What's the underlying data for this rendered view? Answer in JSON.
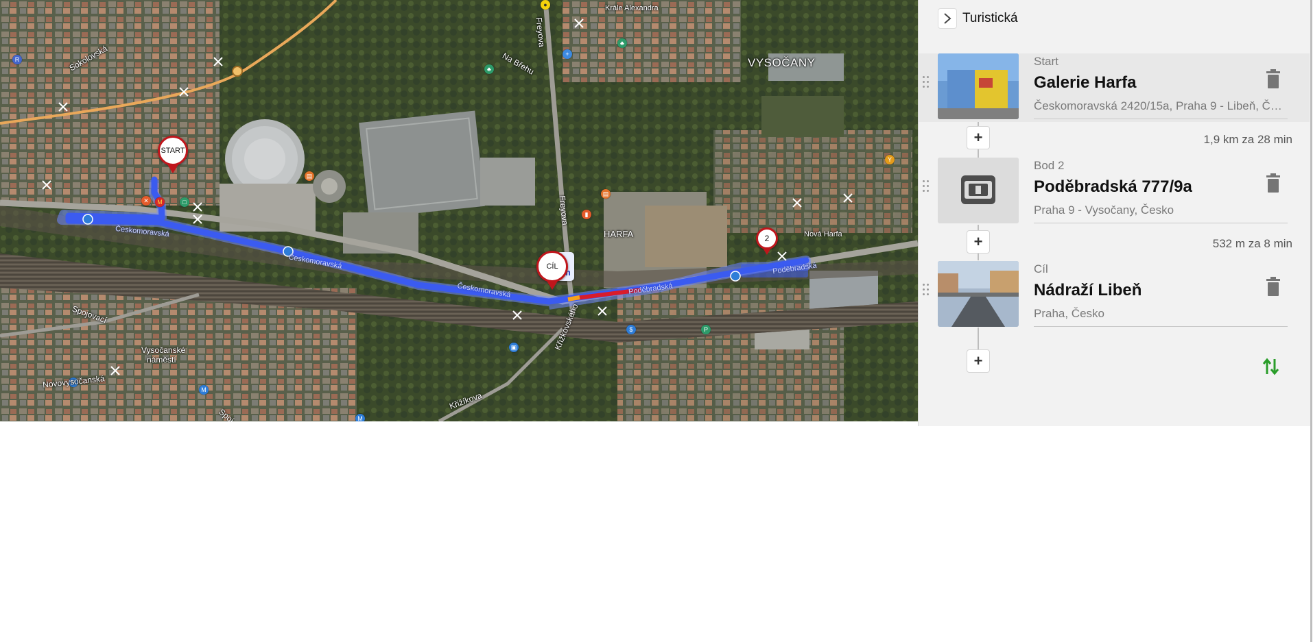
{
  "map": {
    "district_label": "VYSOČANY",
    "area_label": "HARFA",
    "street_labels": {
      "ceskomoravska_1": "Českomoravská",
      "ceskomoravska_2": "Českomoravská",
      "ceskomoravska_3": "Českomoravská",
      "podebradska": "Poděbradská",
      "poděbradska_2": "Poděbradská",
      "freyova_top": "Freyova",
      "freyova_mid": "Freyova",
      "na_brehu": "Na Břehu",
      "sokolovska": "Sokolovská",
      "spojovaci": "Spojovací",
      "vysocanske_namesti_1": "Vysočanské",
      "vysocanske_namesti_2": "náměstí",
      "novovysocanska": "Novovysočanská",
      "krizikova": "Křižíkova",
      "krizkovskeho": "Křižkovského",
      "nova_harfa": "Nová Harfa",
      "krale_alexandra": "Krále Alexandra",
      "spojovaci_bottom": "Spoj"
    },
    "pins": {
      "start": "START",
      "end": "CÍL",
      "waypoint": "2"
    },
    "route_popup": {
      "line1": "in",
      "line2": "km"
    },
    "colors": {
      "route": "#3b5bf0",
      "route_border": "#6f89ff",
      "pin_red": "#c0161c",
      "tram_line": "#f0a04b"
    }
  },
  "panel": {
    "collapse_icon": "chevron-right-icon",
    "route_type": "Turistická",
    "stops": [
      {
        "type": "Start",
        "name": "Galerie Harfa",
        "address": "Českomoravská 2420/15a, Praha 9 - Libeň, Česko",
        "thumb": "galerie-harfa-photo"
      },
      {
        "type": "Bod 2",
        "name": "Poděbradská 777/9a",
        "address": "Praha 9 - Vysočany, Česko",
        "thumb": "atm-icon"
      },
      {
        "type": "Cíl",
        "name": "Nádraží Libeň",
        "address": "Praha, Česko",
        "thumb": "nadrazi-liben-photo"
      }
    ],
    "segments": [
      {
        "text": "1,9 km za 28 min"
      },
      {
        "text": "532 m za 8 min"
      }
    ],
    "add_label": "+",
    "reverse_icon": "swap-arrows-icon",
    "delete_icon": "trash-icon"
  }
}
